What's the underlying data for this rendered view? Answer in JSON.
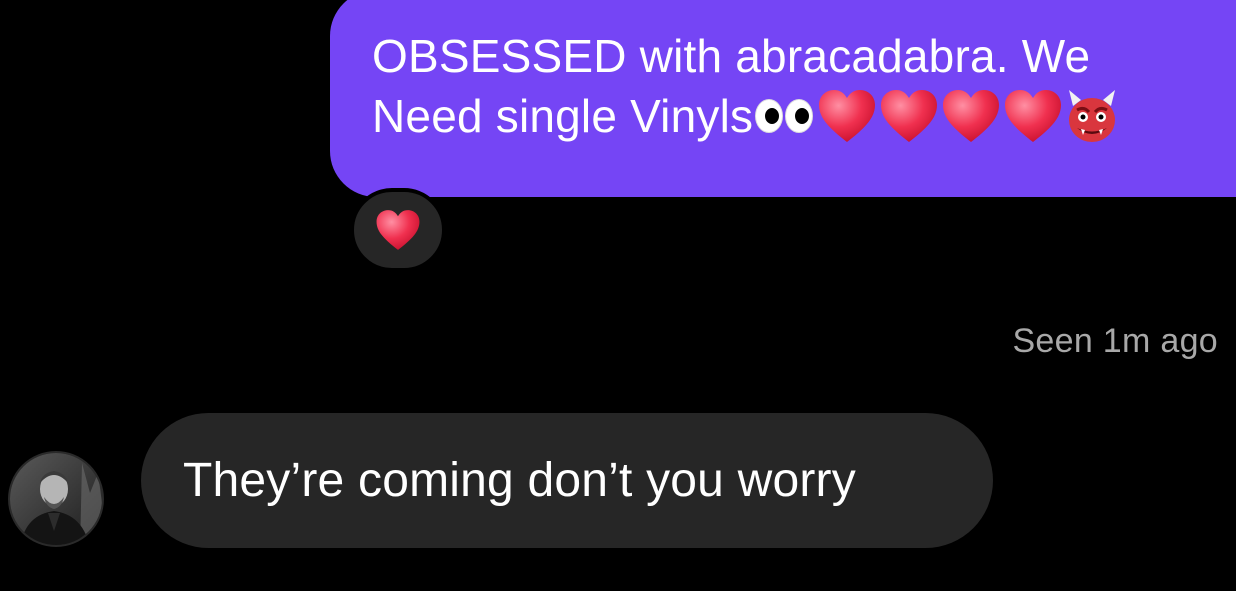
{
  "sent_message": {
    "line1": "OBSESSED with abracadabra. We",
    "line2": "Need single Vinyls",
    "emojis": [
      "eyes-emoji",
      "red-heart-emoji",
      "red-heart-emoji",
      "red-heart-emoji",
      "red-heart-emoji",
      "ogre-emoji"
    ]
  },
  "reaction": {
    "emoji": "red-heart-emoji"
  },
  "seen_status": "Seen 1m ago",
  "received_message": {
    "text": "They’re coming don’t you worry"
  },
  "colors": {
    "sent_bubble": "#7545F5",
    "received_bubble": "#262626",
    "background": "#000000",
    "seen_text": "#A8A8A8",
    "heart": "#F0304F"
  }
}
